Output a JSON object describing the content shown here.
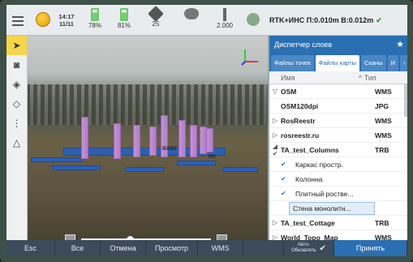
{
  "status": {
    "time": "14:17",
    "date": "11/11",
    "battery1": "78%",
    "battery2": "81%",
    "satellites": "25",
    "antenna_height": "2.000",
    "rtk_text": "RTK+ИНС П:0.010m В:0.012m",
    "rtk_check": "✔"
  },
  "scene": {
    "point_label_1": "BA60",
    "point_label_2": "тёт"
  },
  "panel": {
    "title": "Диспетчер слоев",
    "star": "★",
    "tabs": [
      "Файлы точек",
      "Файлы карты",
      "Сканы",
      "И",
      "›"
    ],
    "active_tab": 1,
    "col_name": "Имя",
    "col_type": "Тип",
    "rows": [
      {
        "exp": "▽",
        "name": "OSM",
        "type": "WMS",
        "sub": false
      },
      {
        "exp": "",
        "name": "OSM120dpi",
        "type": "JPG",
        "sub": false
      },
      {
        "exp": "▷",
        "name": "RosReestr",
        "type": "WMS",
        "sub": false
      },
      {
        "exp": "▷",
        "name": "rosreestr.ru",
        "type": "WMS",
        "sub": false
      },
      {
        "exp": "◢ ✔",
        "name": "TA_test_Columns",
        "type": "TRB",
        "sub": false
      },
      {
        "exp": "",
        "name": "Каркас простр.",
        "type": "",
        "sub": true,
        "check": "✔"
      },
      {
        "exp": "",
        "name": "Колонна",
        "type": "",
        "sub": true,
        "check": "✔"
      },
      {
        "exp": "",
        "name": "Плитный ростве...",
        "type": "",
        "sub": true,
        "check": "✔"
      },
      {
        "exp": "",
        "name": "Стена монолитн...",
        "type": "",
        "sub": true,
        "check": "",
        "highlight": true
      },
      {
        "exp": "▷",
        "name": "TA_test_Cottage",
        "type": "TRB",
        "sub": false
      },
      {
        "exp": "▷",
        "name": "World_Topo_Map",
        "type": "WMS",
        "sub": false
      }
    ]
  },
  "bottom": {
    "esc": "Esc",
    "all": "Все",
    "cancel": "Отмена",
    "view": "Просмотр",
    "wms": "WMS",
    "auto_update_1": "Авто-",
    "auto_update_2": "Обновлять",
    "auto_check": "✔",
    "accept": "Принять"
  },
  "colors": {
    "accent": "#2a6fb2",
    "column": "#c58fd6",
    "slab": "#2c5fb8",
    "selected_tool": "#f7d54a"
  },
  "icons": [
    "menu-icon",
    "globe-icon",
    "battery-icon",
    "satellite-icon",
    "dish-icon",
    "antenna-icon",
    "gnss-icon",
    "cursor-icon",
    "camera-icon",
    "layers-3d-icon",
    "layers-icon",
    "more-icon",
    "measure-icon"
  ]
}
